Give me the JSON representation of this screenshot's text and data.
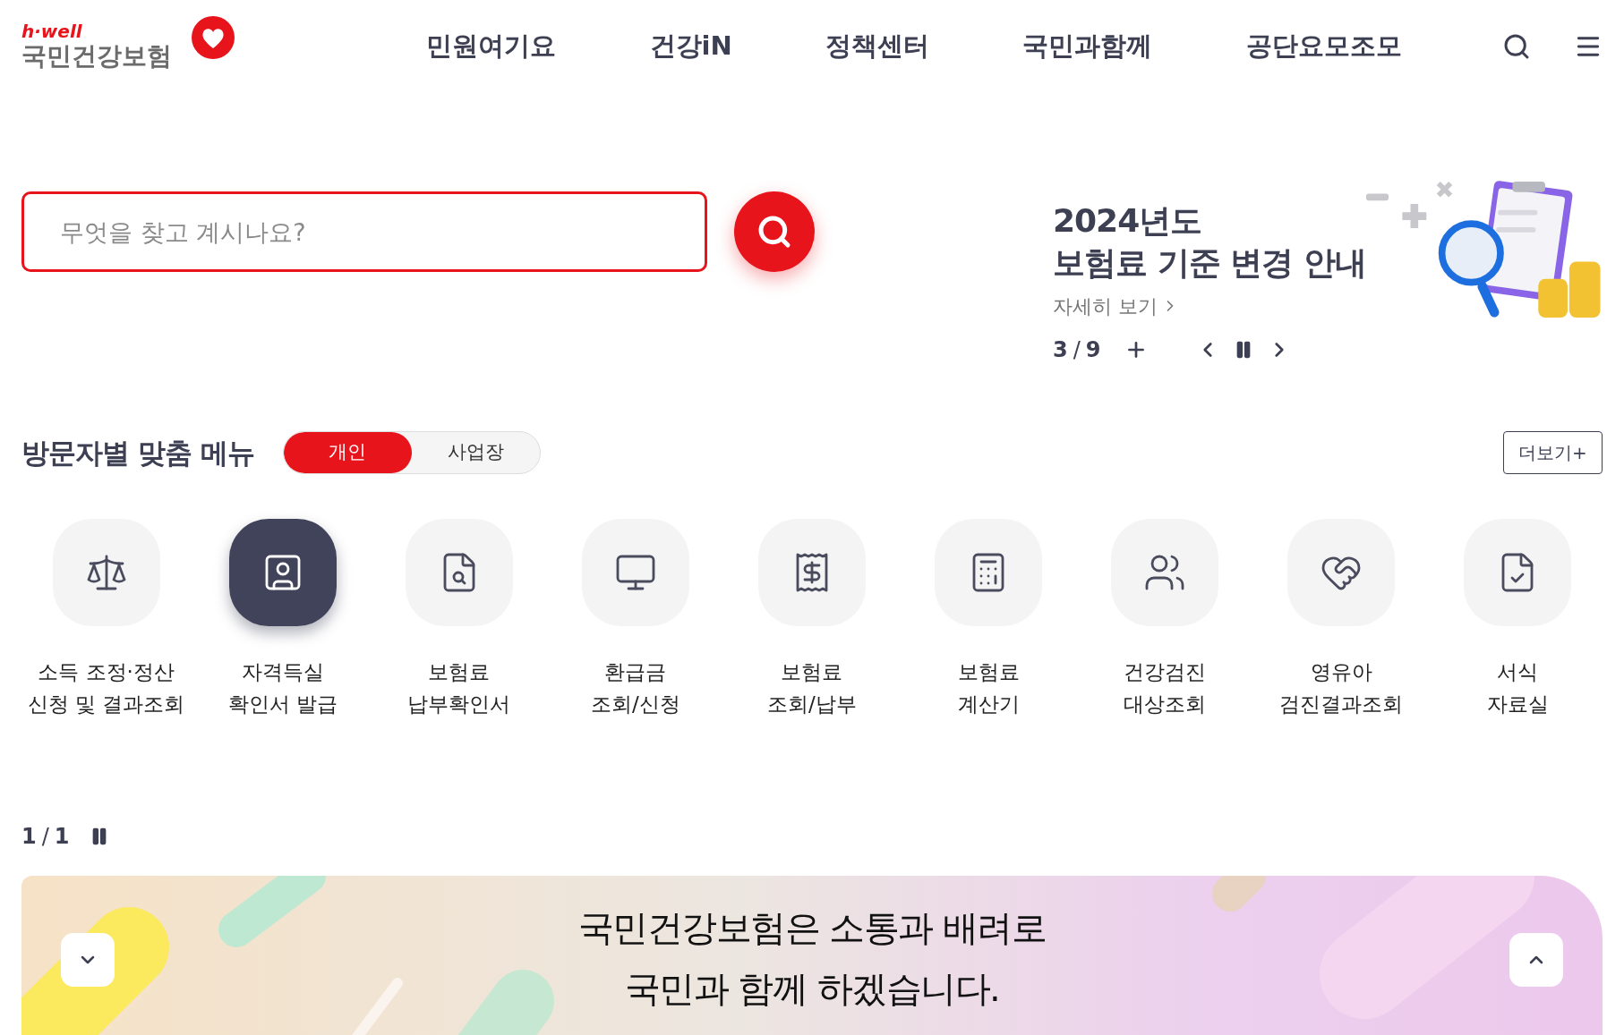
{
  "header": {
    "logo": {
      "tagline": "h·well",
      "name": "국민건강보험"
    },
    "nav": [
      {
        "label": "민원여기요"
      },
      {
        "label": "건강iN"
      },
      {
        "label": "정책센터"
      },
      {
        "label": "국민과함께"
      },
      {
        "label": "공단요모조모"
      }
    ]
  },
  "search": {
    "placeholder": "무엇을 찾고 계시나요?"
  },
  "promo": {
    "title_lines": [
      "2024년도",
      "보험료 기준 변경 안내"
    ],
    "link": "자세히 보기",
    "pager": {
      "current": "3",
      "separator": "/",
      "total": "9"
    }
  },
  "menu": {
    "title": "방문자별 맞춤 메뉴",
    "segments": [
      {
        "label": "개인",
        "selected": true
      },
      {
        "label": "사업장",
        "selected": false
      }
    ],
    "more": "더보기+",
    "items": [
      {
        "lines": [
          "소득 조정·정산",
          "신청 및 결과조회"
        ],
        "selected": false
      },
      {
        "lines": [
          "자격득실",
          "확인서 발급"
        ],
        "selected": true
      },
      {
        "lines": [
          "보험료",
          "납부확인서"
        ],
        "selected": false
      },
      {
        "lines": [
          "환급금",
          "조회/신청"
        ],
        "selected": false
      },
      {
        "lines": [
          "보험료",
          "조회/납부"
        ],
        "selected": false
      },
      {
        "lines": [
          "보험료",
          "계산기"
        ],
        "selected": false
      },
      {
        "lines": [
          "건강검진",
          "대상조회"
        ],
        "selected": false
      },
      {
        "lines": [
          "영유아",
          "검진결과조회"
        ],
        "selected": false
      },
      {
        "lines": [
          "서식",
          "자료실"
        ],
        "selected": false
      }
    ],
    "pager": {
      "current": "1",
      "separator": "/",
      "total": "1"
    }
  },
  "banner": {
    "lines": [
      "국민건강보험은 소통과 배려로",
      "국민과 함께 하겠습니다."
    ]
  }
}
